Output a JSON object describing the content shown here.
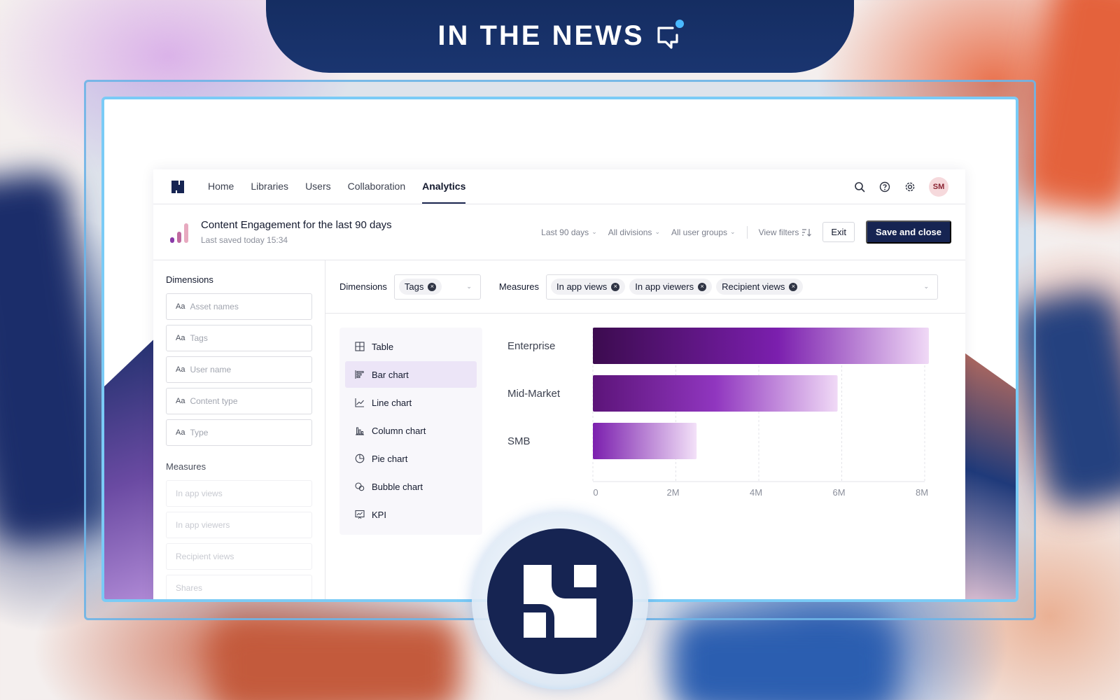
{
  "banner": {
    "title": "IN THE NEWS",
    "icon": "chat-notification-icon"
  },
  "nav": {
    "links": [
      "Home",
      "Libraries",
      "Users",
      "Collaboration",
      "Analytics"
    ],
    "active": "Analytics",
    "avatar_initials": "SM",
    "icons": [
      "search-icon",
      "help-icon",
      "settings-icon"
    ]
  },
  "report": {
    "title": "Content Engagement for the last 90 days",
    "saved": "Last saved today 15:34",
    "filters": [
      "Last 90 days",
      "All divisions",
      "All user groups"
    ],
    "view_filters": "View filters",
    "exit_label": "Exit",
    "save_label": "Save and close"
  },
  "sidebar": {
    "dimensions_heading": "Dimensions",
    "dimension_fields": [
      "Asset names",
      "Tags",
      "User name",
      "Content type",
      "Type"
    ],
    "field_prefix": "Aa",
    "measures_heading": "Measures",
    "measure_fields": [
      "In app views",
      "In app viewers",
      "Recipient views",
      "Shares"
    ]
  },
  "pickers": {
    "dimensions_label": "Dimensions",
    "dimension_chips": [
      "Tags"
    ],
    "measures_label": "Measures",
    "measure_chips": [
      "In app views",
      "In app viewers",
      "Recipient views"
    ]
  },
  "chart_types": {
    "items": [
      "Table",
      "Bar chart",
      "Line chart",
      "Column chart",
      "Pie chart",
      "Bubble chart",
      "KPI"
    ],
    "selected": "Bar chart"
  },
  "chart_data": {
    "type": "bar",
    "orientation": "horizontal",
    "categories": [
      "Enterprise",
      "Mid-Market",
      "SMB"
    ],
    "values": [
      8100000,
      5900000,
      2500000
    ],
    "xlim": [
      0,
      8000000
    ],
    "tick_labels": [
      "0",
      "2M",
      "4M",
      "6M",
      "8M"
    ],
    "tick_values": [
      0,
      2000000,
      4000000,
      6000000,
      8000000
    ],
    "grid": true
  },
  "colors": {
    "accent_navy": "#162452",
    "bar_dark": "#3c0b4f",
    "bar_mid": "#7b1fae",
    "bar_light": "#f0d9f6"
  }
}
